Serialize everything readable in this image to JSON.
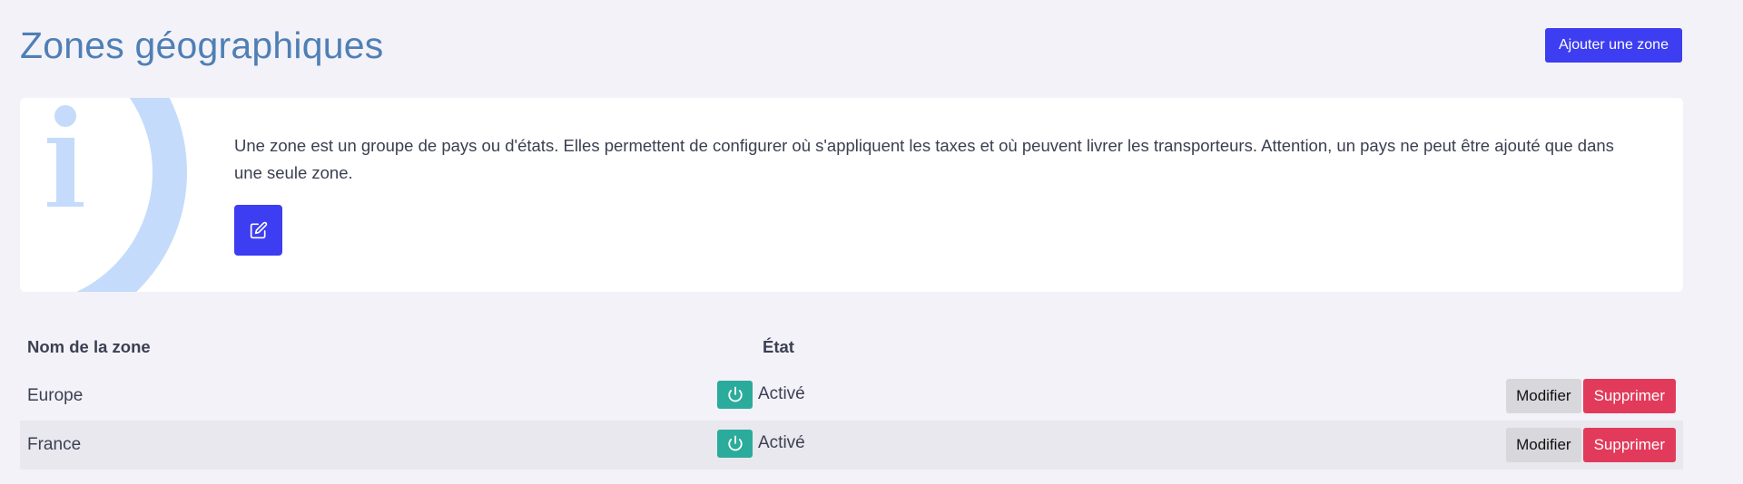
{
  "header": {
    "title": "Zones géographiques",
    "add_button_label": "Ajouter une zone"
  },
  "info": {
    "icon": "info-icon",
    "text": "Une zone est un groupe de pays ou d'états. Elles permettent de configurer où s'appliquent les taxes et où peuvent livrer les transporteurs. Attention, un pays ne peut être ajouté que dans une seule zone.",
    "edit_icon": "edit-icon"
  },
  "table": {
    "columns": {
      "name": "Nom de la zone",
      "state": "État"
    },
    "rows": [
      {
        "name": "Europe",
        "state": "Activé",
        "modify_label": "Modifier",
        "delete_label": "Supprimer"
      },
      {
        "name": "France",
        "state": "Activé",
        "modify_label": "Modifier",
        "delete_label": "Supprimer"
      }
    ]
  },
  "colors": {
    "primary": "#3d3df2",
    "title": "#4f7fb5",
    "success": "#2bab9b",
    "danger": "#e23a5b",
    "info_graphic": "#c4dbfb"
  }
}
